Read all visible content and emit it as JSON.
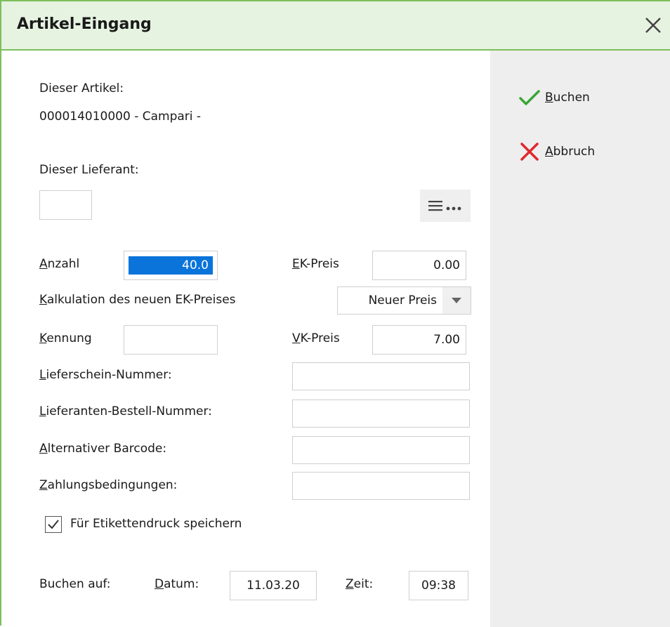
{
  "window": {
    "title": "Artikel-Eingang"
  },
  "article": {
    "label": "Dieser Artikel:",
    "value": "000014010000 - Campari -"
  },
  "supplier": {
    "label": "Dieser Lieferant:",
    "value": ""
  },
  "form": {
    "anzahl": {
      "label_first": "A",
      "label_rest": "nzahl",
      "value": "40.0"
    },
    "ek_preis": {
      "label_first": "E",
      "label_rest": "K-Preis",
      "value": "0.00"
    },
    "kalkulation": {
      "label_first": "K",
      "label_rest": "alkulation des neuen EK-Preises",
      "selected": "Neuer Preis"
    },
    "kennung": {
      "label_first": "K",
      "label_rest": "ennung",
      "value": ""
    },
    "vk_preis": {
      "label_first": "V",
      "label_rest": "K-Preis",
      "value": "7.00"
    },
    "lieferschein": {
      "label_first": "L",
      "label_rest": "ieferschein-Nummer:",
      "value": ""
    },
    "bestellnummer": {
      "label_first": "L",
      "label_rest": "ieferanten-Bestell-Nummer:",
      "value": ""
    },
    "barcode": {
      "label_first": "A",
      "label_rest": "lternativer Barcode:",
      "value": ""
    },
    "zahlung": {
      "label_first": "Z",
      "label_rest": "ahlungsbedingungen:",
      "value": ""
    },
    "etikett": {
      "label": "Für Etikettendruck speichern",
      "checked": true
    }
  },
  "booking": {
    "label": "Buchen auf:",
    "datum": {
      "label_first": "D",
      "label_rest": "atum:",
      "value": "11.03.20"
    },
    "zeit": {
      "label_first": "Z",
      "label_rest": "eit:",
      "value": "09:38"
    }
  },
  "actions": {
    "buchen": {
      "first": "B",
      "rest": "uchen",
      "icon": "checkmark-icon",
      "color": "#3aa635"
    },
    "abbruch": {
      "first": "A",
      "rest": "bbruch",
      "icon": "cross-icon",
      "color": "#e0282e"
    }
  },
  "colors": {
    "accent_border": "#7cbf5a",
    "titlebar_bg": "#e6f3e1",
    "selection": "#0a74da"
  }
}
